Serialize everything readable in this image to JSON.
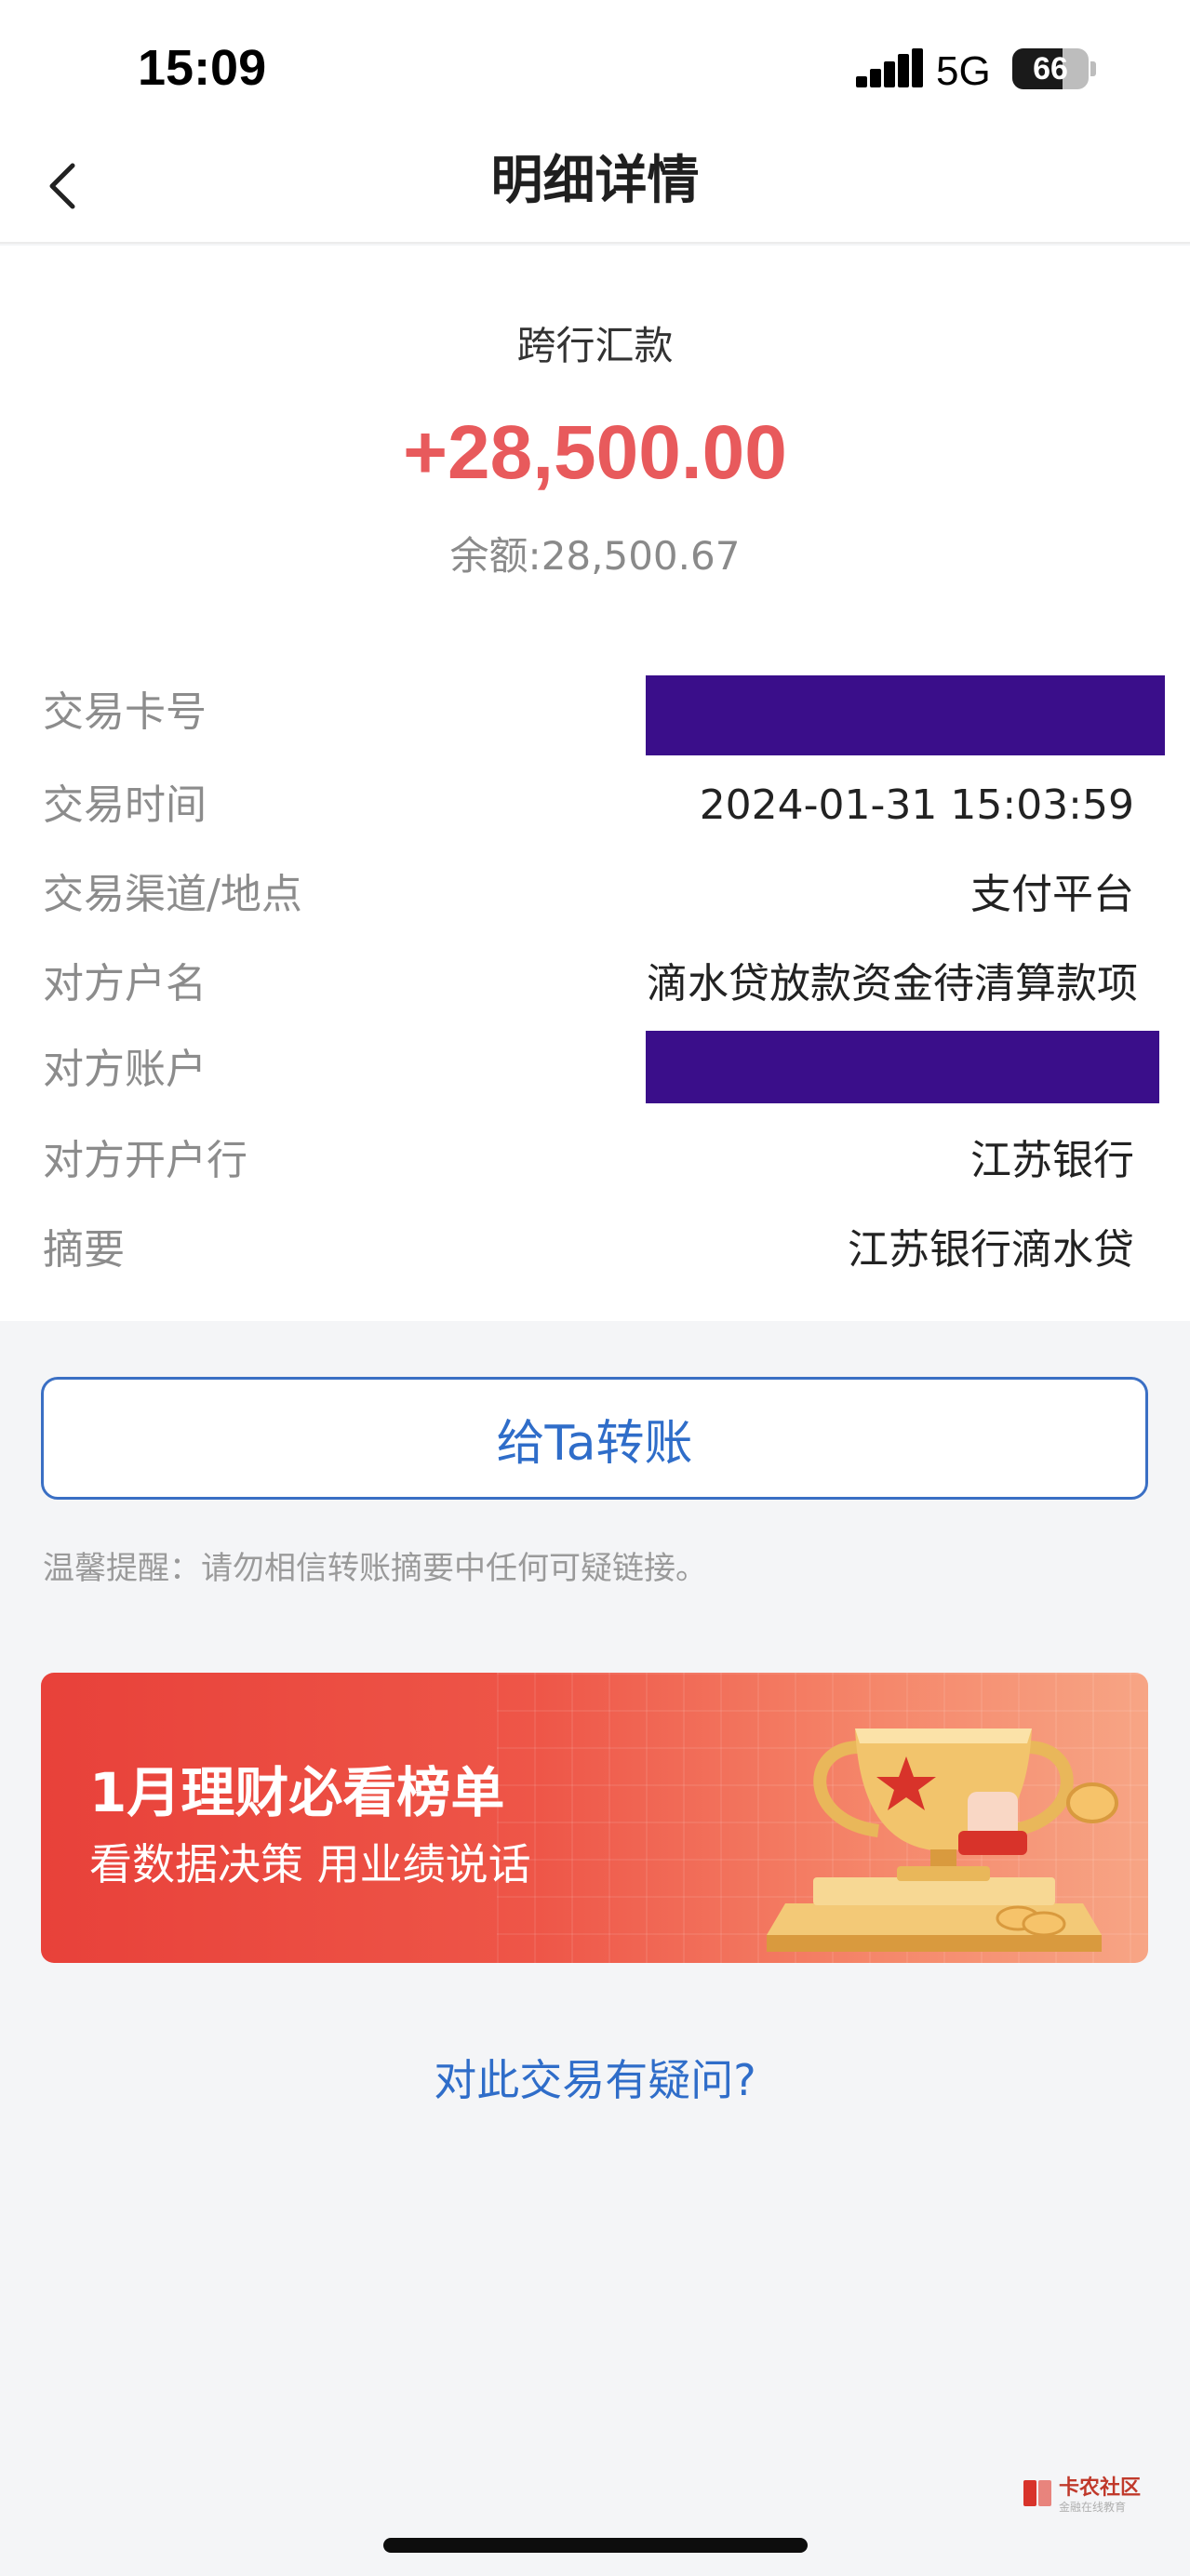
{
  "status_bar": {
    "time": "15:09",
    "network": "5G",
    "battery_level": "66",
    "battery_fraction": 0.66
  },
  "nav": {
    "title": "明细详情",
    "back_icon": "chevron-left-icon"
  },
  "transaction": {
    "type": "跨行汇款",
    "amount": "+28,500.00",
    "balance": "余额:28,500.67",
    "amount_color": "#e85a5c"
  },
  "details": [
    {
      "label": "交易卡号",
      "value": "",
      "redacted": true
    },
    {
      "label": "交易时间",
      "value": "2024-01-31 15:03:59",
      "redacted": false
    },
    {
      "label": "交易渠道/地点",
      "value": "支付平台",
      "redacted": false
    },
    {
      "label": "对方户名",
      "value": "滴水贷放款资金待清算款项",
      "redacted": false
    },
    {
      "label": "对方账户",
      "value": "",
      "redacted": true
    },
    {
      "label": "对方开户行",
      "value": "江苏银行",
      "redacted": false
    },
    {
      "label": "摘要",
      "value": "江苏银行滴水贷",
      "redacted": false
    }
  ],
  "actions": {
    "transfer_label": "给Ta转账",
    "reminder": "温馨提醒：请勿相信转账摘要中任何可疑链接。",
    "question_link": "对此交易有疑问?"
  },
  "banner": {
    "title": "1月理财必看榜单",
    "subtitle": "看数据决策 用业绩说话",
    "icon": "trophy-icon"
  },
  "watermark": {
    "text": "卡农社区",
    "sub": "金融在线教育"
  },
  "colors": {
    "accent_blue": "#2f6dc9",
    "redaction": "#3a0e8a",
    "banner_red": "#e8413a"
  }
}
